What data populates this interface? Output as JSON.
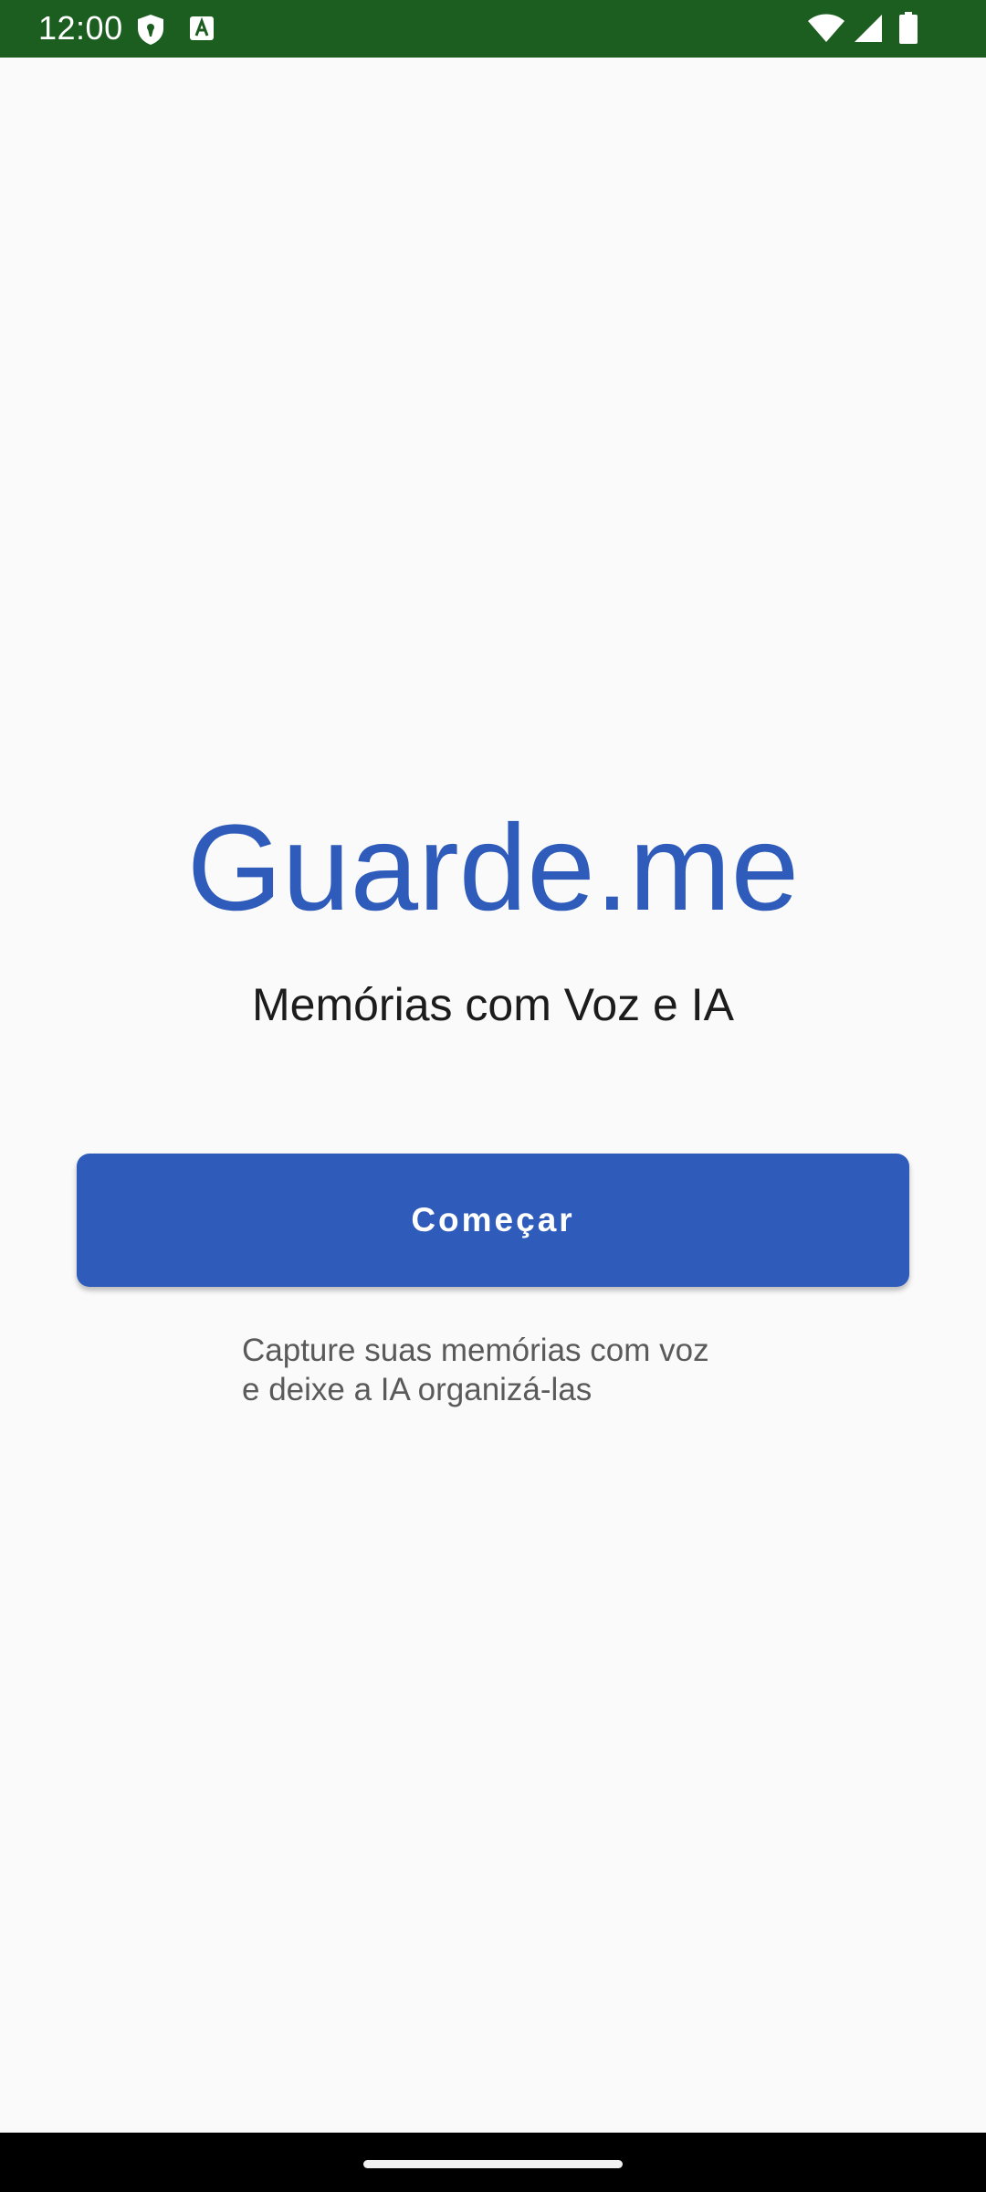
{
  "status_bar": {
    "time": "12:00",
    "icons": [
      "shield-icon",
      "a-icon",
      "wifi-icon",
      "signal-icon",
      "battery-icon"
    ]
  },
  "main": {
    "title": "Guarde.me",
    "subtitle": "Memórias com Voz e IA",
    "start_button_label": "Começar",
    "description_line1": "Capture suas memórias com voz",
    "description_line2": "e deixe a IA organizá-las"
  },
  "colors": {
    "status_bar": "#1b5e20",
    "primary": "#2f5cbb",
    "background": "#fafafa",
    "nav_bar": "#000000"
  }
}
